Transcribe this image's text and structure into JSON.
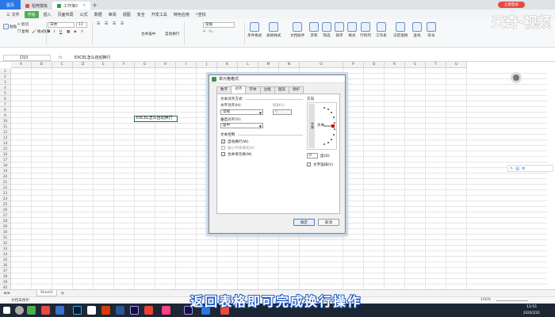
{
  "titlebar": {
    "app_button": "首页",
    "tabs": [
      {
        "label": "稻壳模板",
        "color": "#d9534f"
      },
      {
        "label": "工作簿2",
        "color": "#2e9c4f"
      }
    ],
    "login_label": "立即登录"
  },
  "menubar": {
    "items": [
      "三 文件",
      "开始",
      "插入",
      "页面布局",
      "公式",
      "数据",
      "审阅",
      "视图",
      "安全",
      "开发工具",
      "特色应用",
      "查找"
    ],
    "active": "开始"
  },
  "ribbon": {
    "paste": "粘贴",
    "cut": "剪切",
    "copy": "复制",
    "format_painter": "格式刷",
    "font": "宋体",
    "font_size": "11",
    "merge_center": "合并居中",
    "wrap": "自动换行",
    "number_format": "常规",
    "cond_format": "条件格式",
    "table_style": "表格样式",
    "doc_assist": "文档助手",
    "sum": "求和",
    "filter": "筛选",
    "sort": "排序",
    "format": "格式",
    "row_col": "行和列",
    "worksheet": "工作表",
    "freeze": "冻结窗格",
    "find": "查找",
    "symbol": "符号"
  },
  "formula_bar": {
    "name_box": "O10",
    "fx": "fx",
    "content": "EXCEL怎么自动换行"
  },
  "grid": {
    "columns": [
      "A",
      "B",
      "C",
      "D",
      "E",
      "F",
      "G",
      "H",
      "I",
      "J",
      "K",
      "L",
      "M",
      "N",
      "O",
      "P",
      "Q",
      "R",
      "S",
      "T",
      "U"
    ],
    "rows": [
      "1",
      "2",
      "3",
      "4",
      "5",
      "6",
      "7",
      "8",
      "9",
      "10",
      "11",
      "12",
      "13",
      "14",
      "15",
      "16",
      "17",
      "18",
      "19",
      "20",
      "21",
      "22",
      "23",
      "24",
      "25",
      "26",
      "27",
      "28",
      "29",
      "30",
      "31",
      "32",
      "33",
      "34",
      "35",
      "36",
      "37",
      "38",
      "39",
      "40"
    ],
    "active_cell_text": "EXCEL怎么自动换行"
  },
  "dialog": {
    "title": "单元格格式",
    "tabs": [
      "数字",
      "对齐",
      "字体",
      "边框",
      "图案",
      "保护"
    ],
    "active_tab": "对齐",
    "text_alignment": "文本对齐方式",
    "horizontal_label": "水平对齐(H):",
    "horizontal_value": "常规",
    "indent_label": "缩进(I):",
    "indent_value": "0",
    "vertical_label": "垂直对齐(V):",
    "vertical_value": "居中",
    "text_control": "文本控制",
    "wrap_text": "自动换行(W)",
    "wrap_checked": true,
    "shrink_to_fit": "缩小字体填充(K)",
    "merge_cells": "合并单元格(M)",
    "orientation": "方向",
    "vertical_text": "文本",
    "orient_text": "文本",
    "degrees_value": "0",
    "degrees_label": "度(D)",
    "vertical_text_check": "文字竖排(V)",
    "ok": "确定",
    "cancel": "取消"
  },
  "sheets": {
    "active": "Sheet1"
  },
  "statusbar": {
    "doc_protect": "文档未保护",
    "zoom": "100%"
  },
  "taskbar": {
    "time": "13:51",
    "date": "2020/2/20"
  },
  "overlay": {
    "subtitle": "返回表格即可完成换行操作",
    "watermark": "天奇·视频",
    "watermark_small": "天奇生活"
  },
  "colors": {
    "accent_green": "#217346",
    "wps_blue": "#2b78e4",
    "login_red": "#e94a3f",
    "subtitle_stroke": "#1d56c2"
  }
}
